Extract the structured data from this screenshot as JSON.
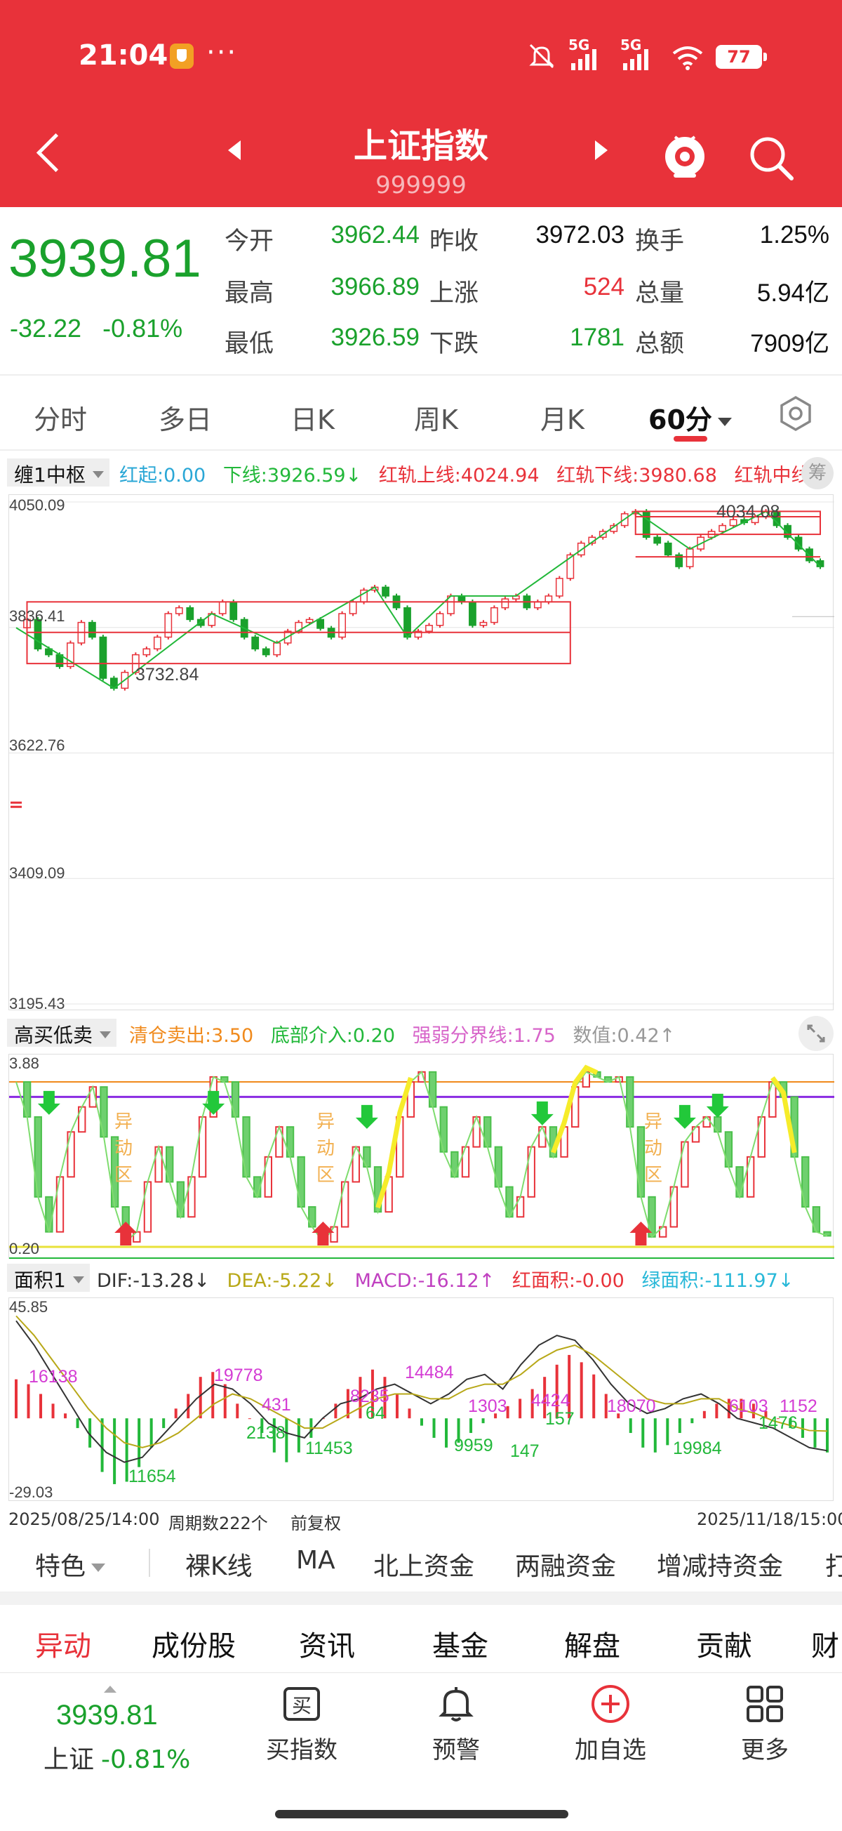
{
  "status_bar": {
    "time": "21:04",
    "dots": "···",
    "signal_1": "5G",
    "signal_2": "5G",
    "battery": "77",
    "icons": [
      "mute-icon",
      "signal-icon",
      "signal-icon",
      "wifi-icon",
      "battery-icon"
    ]
  },
  "header": {
    "title": "上证指数",
    "code": "999999",
    "accent_color": "#e8323a"
  },
  "quote": {
    "price": "3939.81",
    "change": "-32.22",
    "change_pct": "-0.81%",
    "rows": [
      {
        "l1": "今开",
        "v1": "3962.44",
        "l2": "昨收",
        "v2": "3972.03",
        "l3": "换手",
        "v3": "1.25%"
      },
      {
        "l1": "最高",
        "v1": "3966.89",
        "l2": "上涨",
        "v2": "524",
        "l3": "总量",
        "v3": "5.94亿"
      },
      {
        "l1": "最低",
        "v1": "3926.59",
        "l2": "下跌",
        "v2": "1781",
        "l3": "总额",
        "v3": "7909亿"
      }
    ]
  },
  "tabs": [
    {
      "label": "分时"
    },
    {
      "label": "多日"
    },
    {
      "label": "日K"
    },
    {
      "label": "周K"
    },
    {
      "label": "月K"
    },
    {
      "label": "60分",
      "active": true
    }
  ],
  "main_indicator": {
    "selector": "缠1中枢",
    "items": [
      {
        "label": "红起:0.00",
        "color": "#2aa7d6"
      },
      {
        "label": "下线:3926.59↓",
        "color": "#22b83a"
      },
      {
        "label": "红轨上线:4024.94",
        "color": "#e8323a"
      },
      {
        "label": "红轨下线:3980.68",
        "color": "#e8323a"
      },
      {
        "label": "红轨中线",
        "color": "#e8323a"
      }
    ],
    "badge": "筹"
  },
  "osc_indicator": {
    "selector": "高买低卖",
    "items": [
      {
        "label": "清仓卖出:3.50",
        "color": "#f08a1c"
      },
      {
        "label": "底部介入:0.20",
        "color": "#22b83a"
      },
      {
        "label": "强弱分界线:1.75",
        "color": "#d764c9"
      },
      {
        "label": "数值:0.42↑",
        "color": "#999999"
      }
    ]
  },
  "macd_indicator": {
    "selector": "面积1",
    "items": [
      {
        "label": "DIF:-13.28↓",
        "color": "#333333"
      },
      {
        "label": "DEA:-5.22↓",
        "color": "#b8a818"
      },
      {
        "label": "MACD:-16.12↑",
        "color": "#c040c0"
      },
      {
        "label": "红面积:-0.00",
        "color": "#e8323a"
      },
      {
        "label": "绿面积:-111.97↓",
        "color": "#28b8d8"
      }
    ]
  },
  "chart_data": [
    {
      "type": "candlestick",
      "title": "60分",
      "ylim": [
        3195.43,
        4050.09
      ],
      "y_ticks": [
        "4050.09",
        "3622.76",
        "3409.09",
        "3195.43"
      ],
      "annotations": [
        "3836.41",
        "3732.84",
        "4034.08"
      ],
      "series": [
        {
          "name": "close",
          "values": [
            3836,
            3850,
            3800,
            3790,
            3770,
            3810,
            3845,
            3820,
            3750,
            3733,
            3760,
            3790,
            3800,
            3820,
            3860,
            3870,
            3850,
            3840,
            3860,
            3880,
            3850,
            3820,
            3800,
            3790,
            3810,
            3830,
            3845,
            3850,
            3835,
            3820,
            3860,
            3880,
            3900,
            3905,
            3890,
            3870,
            3820,
            3830,
            3840,
            3860,
            3890,
            3880,
            3840,
            3845,
            3870,
            3885,
            3890,
            3870,
            3880,
            3890,
            3920,
            3960,
            3980,
            3990,
            4000,
            4010,
            4030,
            4034,
            3990,
            3980,
            3960,
            3940,
            3970,
            3990,
            4000,
            4010,
            4020,
            4015,
            4025,
            4034,
            4010,
            3990,
            3970,
            3950,
            3940
          ]
        }
      ]
    },
    {
      "type": "line",
      "title": "高买低卖",
      "ylim": [
        0.2,
        3.88
      ],
      "y_ticks": [
        "3.88",
        "0.20"
      ],
      "zone_label": "异动区",
      "reference_lines": [
        3.5,
        1.75,
        0.2
      ],
      "series": [
        {
          "name": "数值",
          "values": [
            3.5,
            2.8,
            1.2,
            0.5,
            1.6,
            2.5,
            3.0,
            3.4,
            2.4,
            1.0,
            0.3,
            0.5,
            1.5,
            2.2,
            1.5,
            0.8,
            1.6,
            2.8,
            3.6,
            3.5,
            2.8,
            1.6,
            1.2,
            2.0,
            2.6,
            2.0,
            1.0,
            0.6,
            0.3,
            0.6,
            1.5,
            2.2,
            1.8,
            0.9,
            1.6,
            2.8,
            3.5,
            3.7,
            3.0,
            2.1,
            1.6,
            2.2,
            2.8,
            2.2,
            1.4,
            0.8,
            1.2,
            2.2,
            2.6,
            2.0,
            2.6,
            3.4,
            3.7,
            3.6,
            3.5,
            3.6,
            2.6,
            1.2,
            0.4,
            0.6,
            1.4,
            2.3,
            2.6,
            2.8,
            2.5,
            1.8,
            1.2,
            2.0,
            2.8,
            3.5,
            3.2,
            2.0,
            1.0,
            0.5,
            0.42
          ]
        }
      ]
    },
    {
      "type": "bar",
      "title": "面积1",
      "ylim": [
        -29.03,
        45.85
      ],
      "y_ticks": [
        "45.85",
        "-29.03"
      ],
      "area_labels": [
        "16138",
        "11654",
        "19778",
        "431",
        "2138",
        "8235",
        "64",
        "11453",
        "14484",
        "1303",
        "9959",
        "147",
        "4424",
        "157",
        "18070",
        "19984",
        "6103",
        "1152",
        "1476"
      ],
      "series": [
        {
          "name": "MACD",
          "values": [
            16,
            14,
            10,
            6,
            2,
            -4,
            -12,
            -22,
            -27,
            -26,
            -20,
            -12,
            -4,
            4,
            10,
            17,
            19,
            14,
            6,
            0,
            -6,
            -14,
            -18,
            -14,
            -8,
            0,
            6,
            12,
            17,
            20,
            17,
            10,
            4,
            -3,
            -8,
            -12,
            -10,
            -6,
            -2,
            2,
            5,
            8,
            12,
            17,
            22,
            26,
            23,
            18,
            10,
            2,
            -6,
            -12,
            -14,
            -11,
            -6,
            -2,
            3,
            6,
            8,
            8,
            6,
            3,
            0,
            -4,
            -8,
            -12,
            -14
          ]
        },
        {
          "name": "DIF",
          "values": [
            40,
            30,
            18,
            6,
            -6,
            -14,
            -18,
            -16,
            -8,
            0,
            8,
            14,
            12,
            6,
            -2,
            -6,
            -8,
            0,
            6,
            8,
            12,
            14,
            10,
            6,
            10,
            16,
            18,
            12,
            22,
            30,
            34,
            32,
            24,
            14,
            6,
            2,
            4,
            8,
            10,
            6,
            0,
            -2,
            -4,
            -8,
            -12,
            -13.28
          ]
        },
        {
          "name": "DEA",
          "values": [
            42,
            34,
            24,
            14,
            4,
            -4,
            -10,
            -12,
            -10,
            -6,
            0,
            6,
            10,
            8,
            4,
            0,
            -4,
            -4,
            0,
            4,
            8,
            10,
            10,
            8,
            8,
            12,
            14,
            14,
            18,
            24,
            28,
            30,
            26,
            20,
            14,
            8,
            6,
            6,
            8,
            8,
            4,
            2,
            -1,
            -3,
            -5,
            -5.22
          ]
        }
      ]
    }
  ],
  "chart_footer": {
    "start": "2025/08/25/14:00",
    "periods": "周期数222个",
    "adjust": "前复权",
    "end": "2025/11/18/15:00"
  },
  "features": [
    "特色",
    "裸K线",
    "MA",
    "北上资金",
    "两融资金",
    "增减持资金",
    "打"
  ],
  "bottom_tabs": [
    "异动",
    "成份股",
    "资讯",
    "基金",
    "解盘",
    "贡献",
    "财"
  ],
  "bottom_nav": {
    "price": "3939.81",
    "name": "上证",
    "pct": "-0.81%",
    "items": [
      "买指数",
      "预警",
      "加自选",
      "更多"
    ],
    "buy_glyph": "买"
  }
}
